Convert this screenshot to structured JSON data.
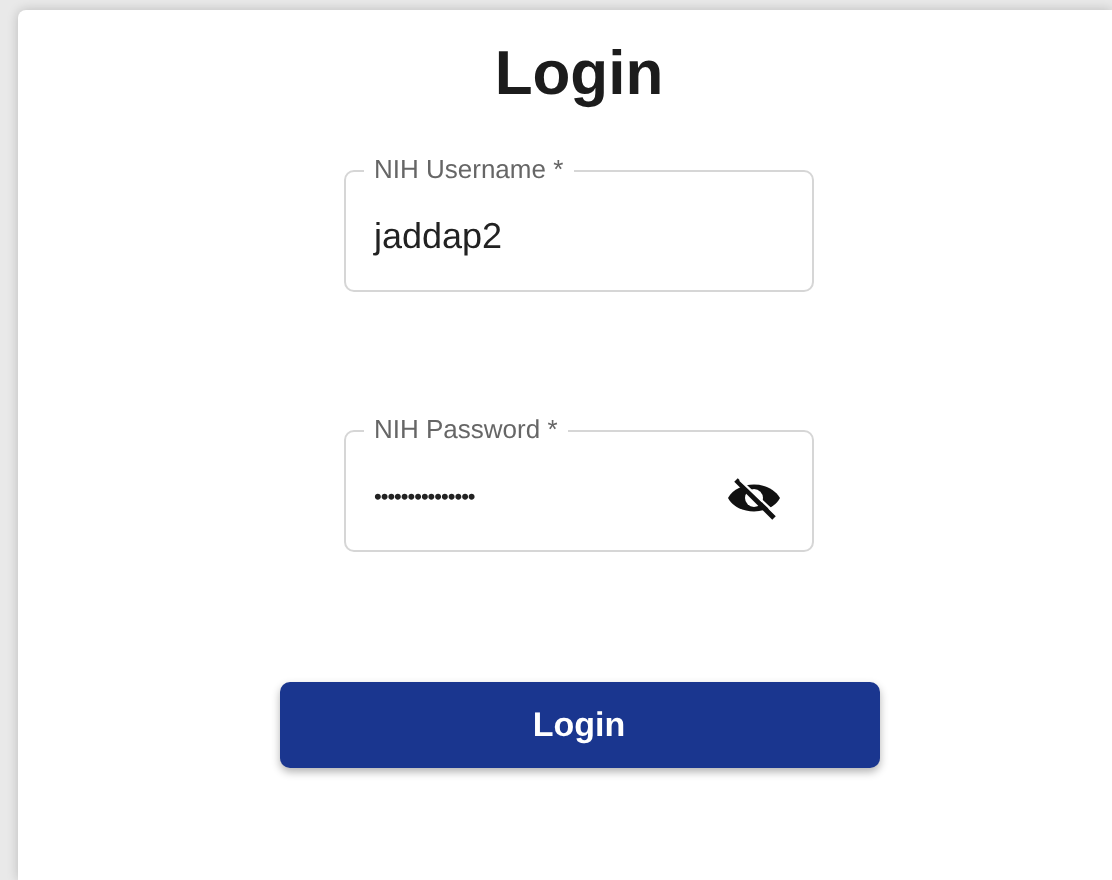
{
  "title": "Login",
  "fields": [
    {
      "label": "NIH Username *",
      "value": "jaddap2",
      "kind": "text"
    },
    {
      "label": "NIH Password *",
      "value": "•••••••••••••••",
      "kind": "password",
      "visible": false
    }
  ],
  "button": "Login"
}
